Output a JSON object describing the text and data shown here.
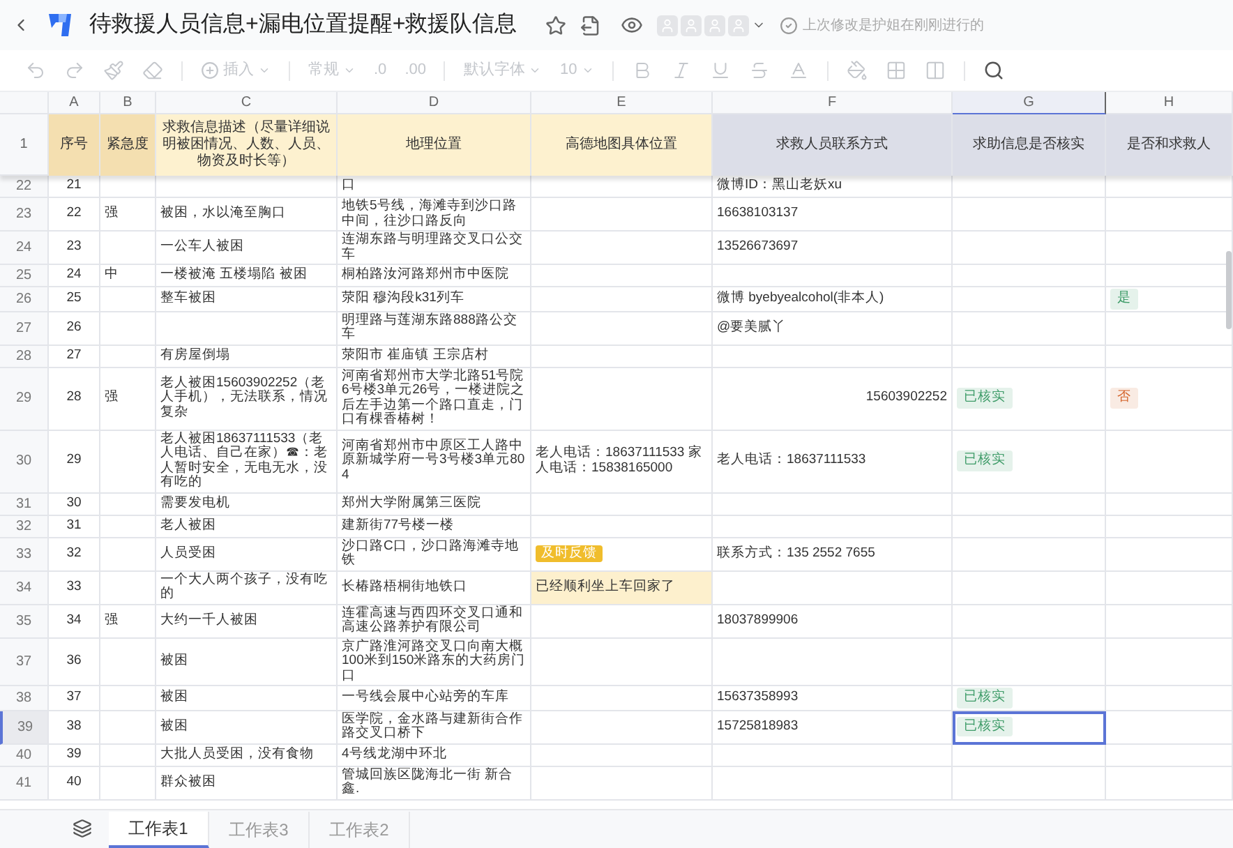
{
  "title_bar": {
    "title": "待救援人员信息+漏电位置提醒+救援队信息",
    "last_edit": "上次修改是护姐在刚刚进行的"
  },
  "toolbar": {
    "disabled": true,
    "insert": "插入",
    "number_format": "常规",
    "decimals": [
      ".0",
      ".00"
    ],
    "font": "默认字体",
    "font_size": "10"
  },
  "columns": [
    {
      "letter": "A",
      "selected": false
    },
    {
      "letter": "B",
      "selected": false
    },
    {
      "letter": "C",
      "selected": false
    },
    {
      "letter": "D",
      "selected": false
    },
    {
      "letter": "E",
      "selected": false
    },
    {
      "letter": "F",
      "selected": false
    },
    {
      "letter": "G",
      "selected": true
    },
    {
      "letter": "H",
      "selected": false
    }
  ],
  "header_row": {
    "row": "1",
    "cells": [
      {
        "text": "序号",
        "color": "#f4dfb0"
      },
      {
        "text": "紧急度",
        "color": "#f4dfb0"
      },
      {
        "text": "求救信息描述（尽量详细说明被困情况、人数、人员、物资及时长等）",
        "color": "#fdf1cf"
      },
      {
        "text": "地理位置",
        "color": "#fdf1cf"
      },
      {
        "text": "高德地图具体位置",
        "color": "#fdf1cf"
      },
      {
        "text": "求救人员联系方式",
        "color": "#dcdee8"
      },
      {
        "text": "求助信息是否核实",
        "color": "#dcdee8"
      },
      {
        "text": "是否和求救人",
        "color": "#dcdee8"
      }
    ]
  },
  "rows": [
    {
      "row": "22",
      "selected": false,
      "cells": [
        "21",
        "",
        "",
        "口",
        "",
        "微博ID：黑山老妖xu",
        "",
        ""
      ]
    },
    {
      "row": "23",
      "selected": false,
      "cells": [
        "22",
        "强",
        "被困，水以淹至胸口",
        "地铁5号线，海滩寺到沙口路中间，往沙口路反向",
        "",
        "16638103137",
        "",
        ""
      ]
    },
    {
      "row": "24",
      "selected": false,
      "cells": [
        "23",
        "",
        "一公车人被困",
        "连湖东路与明理路交叉口公交车",
        "",
        "13526673697",
        "",
        ""
      ]
    },
    {
      "row": "25",
      "selected": false,
      "cells": [
        "24",
        "中",
        "一楼被淹 五楼塌陷 被困",
        "桐柏路汝河路郑州市中医院",
        "",
        "",
        "",
        ""
      ]
    },
    {
      "row": "26",
      "selected": false,
      "cells": [
        "25",
        "",
        "整车被困",
        "荥阳 穆沟段k31列车",
        "",
        "微博  byebyealcohol(非本人)",
        "",
        {
          "kind": "tag",
          "text": "是",
          "color": "#3f9c69"
        }
      ]
    },
    {
      "row": "27",
      "selected": false,
      "cells": [
        "26",
        "",
        "",
        "明理路与莲湖东路888路公交车",
        "",
        "@要美腻丫",
        "",
        ""
      ]
    },
    {
      "row": "28",
      "selected": false,
      "cells": [
        "27",
        "",
        "有房屋倒塌",
        "荥阳市 崔庙镇 王宗店村",
        "",
        "",
        "",
        ""
      ]
    },
    {
      "row": "29",
      "selected": false,
      "cells": [
        "28",
        "强",
        "老人被困15603902252（老人手机），无法联系，情况复杂",
        "河南省郑州市大学北路51号院6号楼3单元26号，一楼进院之后左手边第一个路口直走，门口有棵香椿树！",
        "",
        {
          "kind": "number",
          "text": "15603902252"
        },
        {
          "kind": "tag",
          "text": "已核实",
          "color": "#3f9c69"
        },
        {
          "kind": "tag",
          "text": "否",
          "color": "#d5662e"
        }
      ]
    },
    {
      "row": "30",
      "selected": false,
      "cells": [
        "29",
        "",
        "老人被困18637111533（老人电话、自己在家）☎：老人暂时安全，无电无水，没有吃的",
        "河南省郑州市中原区工人路中原新城学府一号3号楼3单元804",
        "老人电话：18637111533 家人电话：15838165000",
        "老人电话：18637111533",
        {
          "kind": "tag",
          "text": "已核实",
          "color": "#3f9c69"
        },
        ""
      ]
    },
    {
      "row": "31",
      "selected": false,
      "cells": [
        "30",
        "",
        "需要发电机",
        "郑州大学附属第三医院",
        "",
        "",
        "",
        ""
      ]
    },
    {
      "row": "32",
      "selected": false,
      "cells": [
        "31",
        "",
        "老人被困",
        "建新街77号楼一楼",
        "",
        "",
        "",
        ""
      ]
    },
    {
      "row": "33",
      "selected": false,
      "cells": [
        "32",
        "",
        "人员受困",
        "沙口路C口，沙口路海滩寺地铁",
        {
          "kind": "solid_tag",
          "text": "及时反馈",
          "color": "#f0bd2c"
        },
        "联系方式：135 2552 7655",
        "",
        ""
      ]
    },
    {
      "row": "34",
      "selected": false,
      "cells": [
        "33",
        "",
        "一个大人两个孩子，没有吃的",
        "长椿路梧桐街地铁口",
        {
          "kind": "fill",
          "text": "已经顺利坐上车回家了",
          "color": "#fdf0cd"
        },
        "",
        "",
        ""
      ]
    },
    {
      "row": "35",
      "selected": false,
      "cells": [
        "34",
        "强",
        "大约一千人被困",
        "连霍高速与西四环交叉口通和高速公路养护有限公司",
        "",
        "18037899906",
        "",
        ""
      ]
    },
    {
      "row": "37",
      "selected": false,
      "cells": [
        "36",
        "",
        "被困",
        "京广路淮河路交叉口向南大概100米到150米路东的大药房门口",
        "",
        "",
        "",
        ""
      ]
    },
    {
      "row": "38",
      "selected": false,
      "cells": [
        "37",
        "",
        "被困",
        "一号线会展中心站旁的车库",
        "",
        "15637358993",
        {
          "kind": "tag",
          "text": "已核实",
          "color": "#3f9c69"
        },
        ""
      ]
    },
    {
      "row": "39",
      "selected": true,
      "cells": [
        "38",
        "",
        "被困",
        "医学院，金水路与建新街合作路交叉口桥下",
        "",
        "15725818983",
        {
          "kind": "tag",
          "text": "已核实",
          "color": "#3f9c69"
        },
        ""
      ]
    },
    {
      "row": "40",
      "selected": false,
      "cells": [
        "39",
        "",
        "大批人员受困，没有食物",
        "4号线龙湖中环北",
        "",
        "",
        "",
        ""
      ]
    },
    {
      "row": "41",
      "selected": false,
      "cells": [
        "40",
        "",
        "群众被困",
        "管城回族区陇海北一街 新合鑫.",
        "",
        "",
        "",
        ""
      ]
    }
  ],
  "sheet_tabs": [
    {
      "label": "工作表1",
      "selected": true
    },
    {
      "label": "工作表3",
      "selected": false
    },
    {
      "label": "工作表2",
      "selected": false
    }
  ]
}
